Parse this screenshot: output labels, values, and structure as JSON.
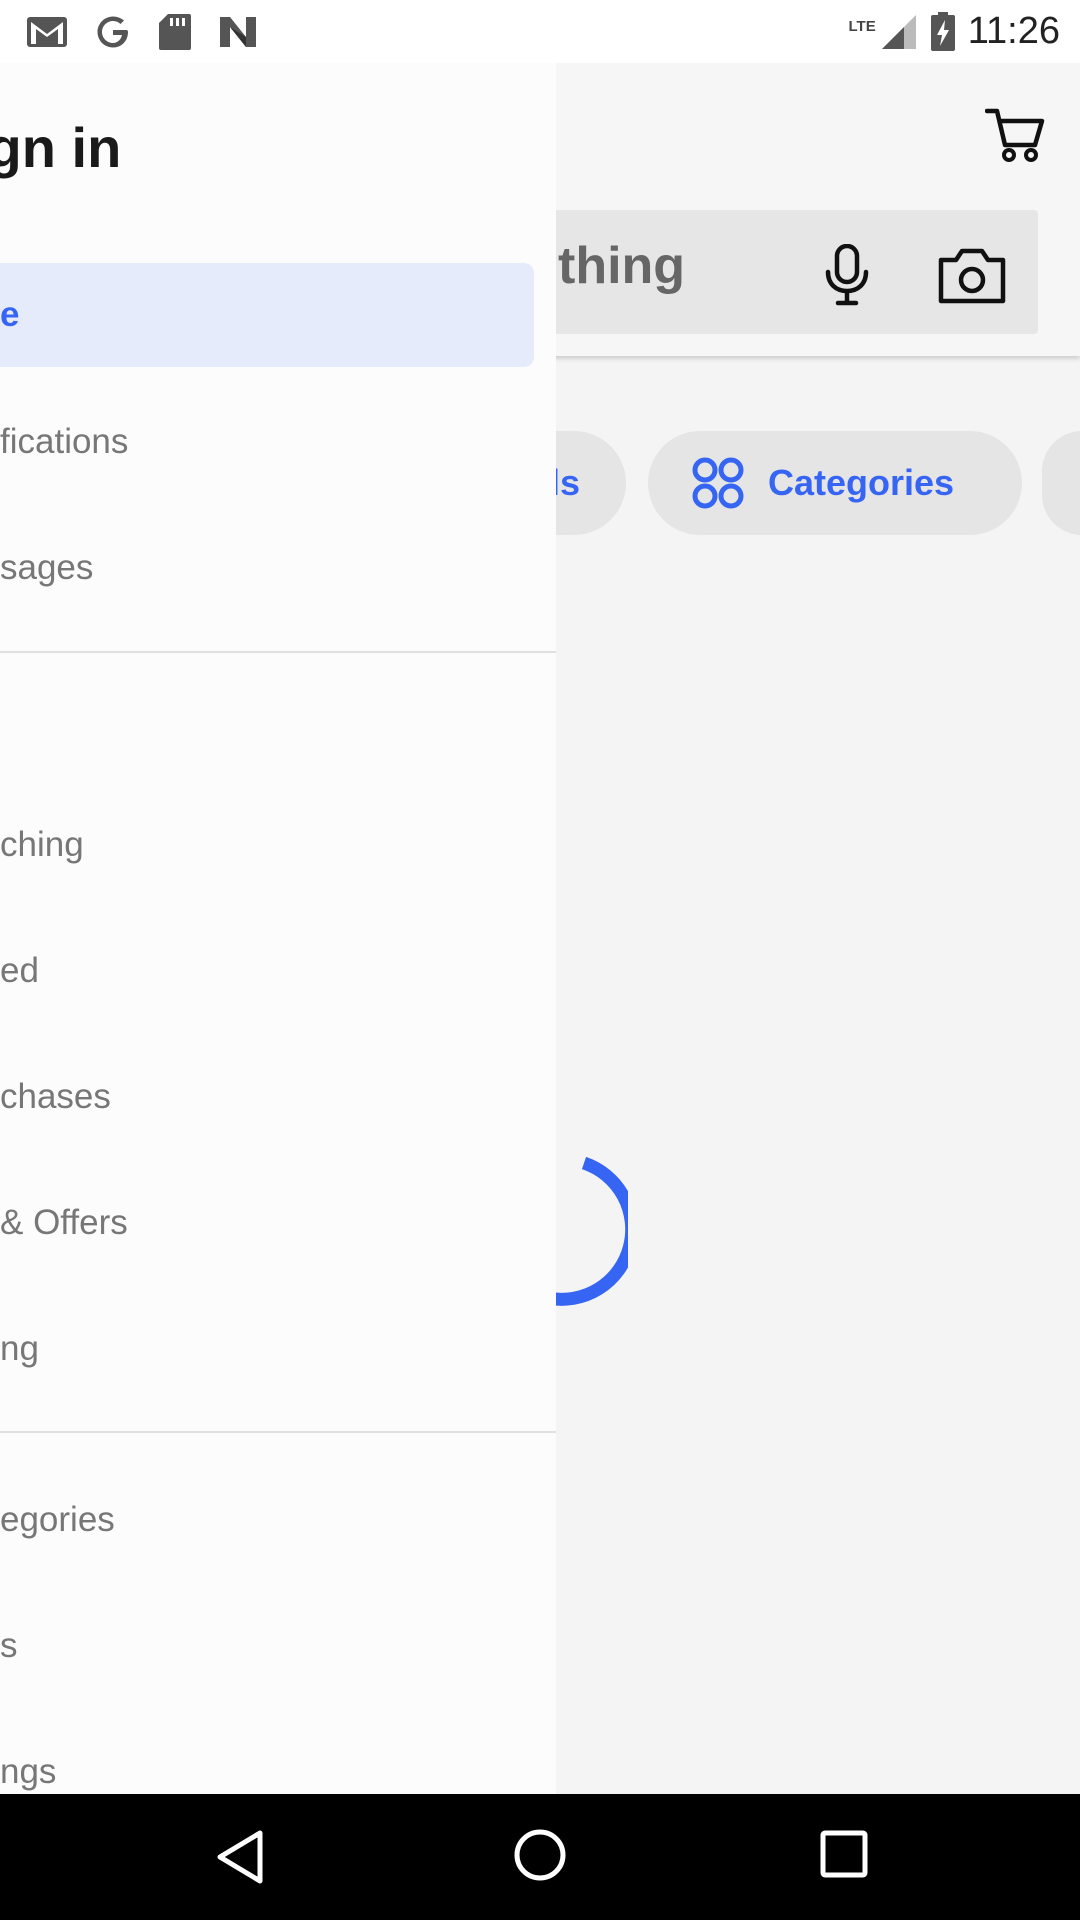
{
  "status_bar": {
    "time": "11:26",
    "network": "LTE",
    "icons": [
      "gmail-icon",
      "google-icon",
      "sd-card-icon",
      "n-app-icon"
    ]
  },
  "main": {
    "search_placeholder_visible": "thing",
    "chips": [
      {
        "label": "ls"
      },
      {
        "label": "Categories"
      }
    ],
    "accent_color": "#3665f3"
  },
  "drawer": {
    "title": "ign in",
    "items": [
      {
        "label": "e",
        "active": true
      },
      {
        "label": "fications"
      },
      {
        "label": "sages"
      },
      {
        "label": "ching"
      },
      {
        "label": "ed"
      },
      {
        "label": "chases"
      },
      {
        "label": " & Offers"
      },
      {
        "label": "ng"
      },
      {
        "label": "egories"
      },
      {
        "label": "s"
      },
      {
        "label": "ngs"
      }
    ]
  }
}
